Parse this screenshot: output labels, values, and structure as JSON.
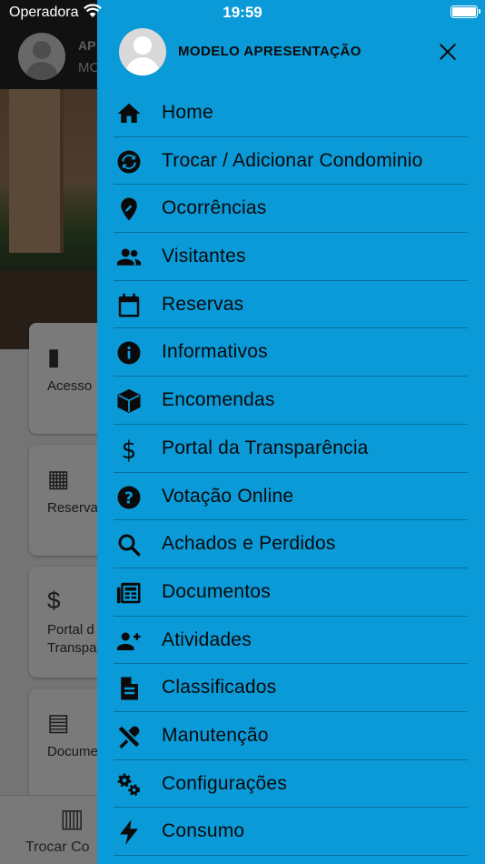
{
  "status_bar": {
    "carrier": "Operadora",
    "time": "19:59"
  },
  "background": {
    "header_name": "AP",
    "header_sub": "MO",
    "cards": [
      {
        "label": "Acesso",
        "icon": "door-icon"
      },
      {
        "label": "Reserva",
        "icon": "calendar-icon"
      },
      {
        "label": "Portal d\nTranspa",
        "icon": "dollar-icon"
      },
      {
        "label": "Docume",
        "icon": "newspaper-icon"
      }
    ],
    "bottom_bar_label": "Trocar Co"
  },
  "drawer": {
    "title": "MODELO APRESENTAÇÃO",
    "items": [
      {
        "label": "Home",
        "icon": "home-icon"
      },
      {
        "label": "Trocar / Adicionar Condominio",
        "icon": "swap-icon"
      },
      {
        "label": "Ocorrências",
        "icon": "edit-location-icon"
      },
      {
        "label": "Visitantes",
        "icon": "people-icon"
      },
      {
        "label": "Reservas",
        "icon": "calendar-icon"
      },
      {
        "label": "Informativos",
        "icon": "info-icon"
      },
      {
        "label": "Encomendas",
        "icon": "package-icon"
      },
      {
        "label": "Portal da Transparência",
        "icon": "dollar-icon"
      },
      {
        "label": "Votação Online",
        "icon": "help-icon"
      },
      {
        "label": "Achados e Perdidos",
        "icon": "search-icon"
      },
      {
        "label": "Documentos",
        "icon": "newspaper-icon"
      },
      {
        "label": "Atividades",
        "icon": "group-add-icon"
      },
      {
        "label": "Classificados",
        "icon": "document-icon"
      },
      {
        "label": "Manutenção",
        "icon": "tools-icon"
      },
      {
        "label": "Configurações",
        "icon": "gears-icon"
      },
      {
        "label": "Consumo",
        "icon": "bolt-icon"
      }
    ]
  },
  "colors": {
    "drawer_bg": "#0b9ad8",
    "text": "#0a0a0a",
    "header_bg": "#222222"
  }
}
